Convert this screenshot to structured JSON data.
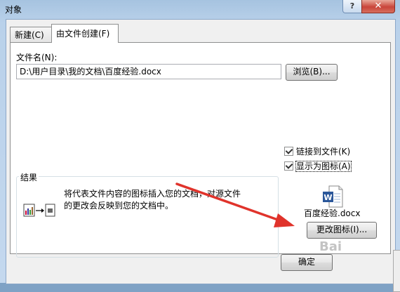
{
  "window": {
    "title": "对象",
    "help_label": "?",
    "close_label": "✕"
  },
  "tabs": [
    {
      "label": "新建(C)"
    },
    {
      "label": "由文件创建(F)"
    }
  ],
  "file": {
    "label": "文件名(N):",
    "value": "D:\\用户目录\\我的文档\\百度经验.docx",
    "browse_label": "浏览(B)..."
  },
  "options": {
    "link_label": "链接到文件(K)",
    "link_checked": true,
    "icon_label": "显示为图标(A)",
    "icon_checked": true
  },
  "result": {
    "label": "结果",
    "text": "将代表文件内容的图标插入您的文档，对源文件的更改会反映到您的文档中。"
  },
  "icon_preview": {
    "caption": "百度经验.docx",
    "icon": "word-document-icon",
    "color": "#2b579a"
  },
  "buttons": {
    "change_icon": "更改图标(I)...",
    "ok": "确定"
  },
  "watermark": "Bai"
}
